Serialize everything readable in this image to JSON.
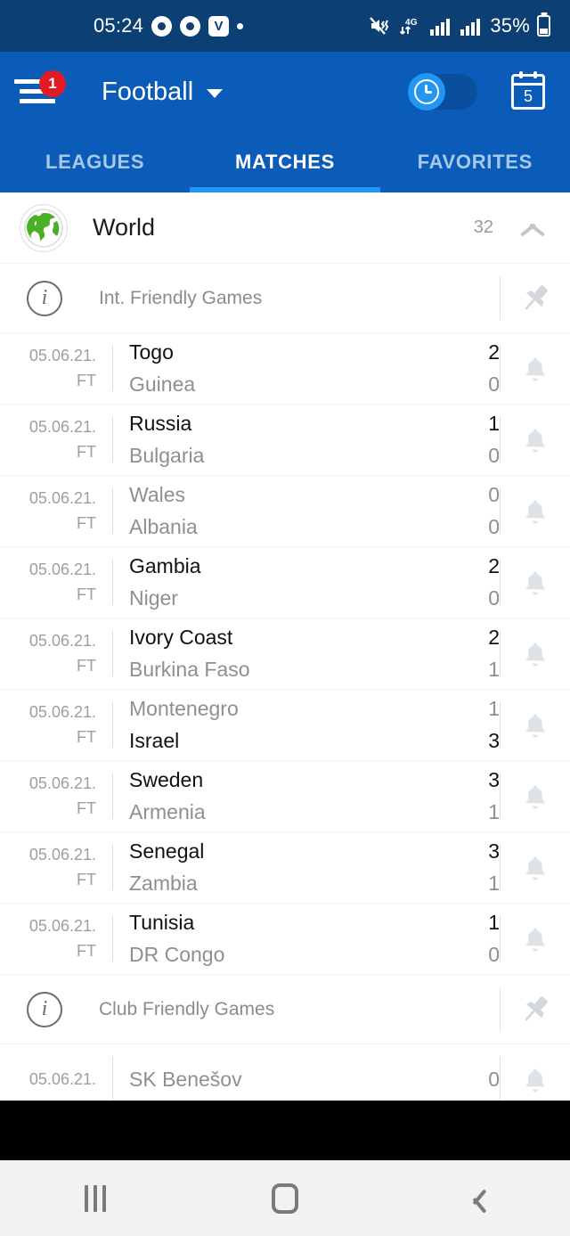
{
  "status_bar": {
    "time": "05:24",
    "battery_percent": "35%",
    "network": "4G",
    "icons": [
      "media-player-icon",
      "chrome-icon",
      "vivaldi-icon",
      "dot-icon",
      "mute-vibrate-icon",
      "4g-data-icon",
      "signal-bars-icon",
      "signal-bars-2-icon",
      "battery-icon"
    ]
  },
  "app_bar": {
    "menu_badge": "1",
    "title": "Football",
    "toggle_state": "off",
    "calendar_day": "5"
  },
  "tabs": [
    {
      "label": "LEAGUES",
      "active": false
    },
    {
      "label": "MATCHES",
      "active": true
    },
    {
      "label": "FAVORITES",
      "active": false
    }
  ],
  "country": {
    "name": "World",
    "count": "32",
    "collapse_icon": "chevron-up-icon"
  },
  "sections": [
    {
      "league": "Int. Friendly Games",
      "matches": [
        {
          "date": "05.06.21.",
          "status": "FT",
          "home": "Togo",
          "away": "Guinea",
          "home_score": "2",
          "away_score": "0",
          "home_win": true,
          "away_win": false
        },
        {
          "date": "05.06.21.",
          "status": "FT",
          "home": "Russia",
          "away": "Bulgaria",
          "home_score": "1",
          "away_score": "0",
          "home_win": true,
          "away_win": false
        },
        {
          "date": "05.06.21.",
          "status": "FT",
          "home": "Wales",
          "away": "Albania",
          "home_score": "0",
          "away_score": "0",
          "home_win": false,
          "away_win": false
        },
        {
          "date": "05.06.21.",
          "status": "FT",
          "home": "Gambia",
          "away": "Niger",
          "home_score": "2",
          "away_score": "0",
          "home_win": true,
          "away_win": false
        },
        {
          "date": "05.06.21.",
          "status": "FT",
          "home": "Ivory Coast",
          "away": "Burkina Faso",
          "home_score": "2",
          "away_score": "1",
          "home_win": true,
          "away_win": false
        },
        {
          "date": "05.06.21.",
          "status": "FT",
          "home": "Montenegro",
          "away": "Israel",
          "home_score": "1",
          "away_score": "3",
          "home_win": false,
          "away_win": true
        },
        {
          "date": "05.06.21.",
          "status": "FT",
          "home": "Sweden",
          "away": "Armenia",
          "home_score": "3",
          "away_score": "1",
          "home_win": true,
          "away_win": false
        },
        {
          "date": "05.06.21.",
          "status": "FT",
          "home": "Senegal",
          "away": "Zambia",
          "home_score": "3",
          "away_score": "1",
          "home_win": true,
          "away_win": false
        },
        {
          "date": "05.06.21.",
          "status": "FT",
          "home": "Tunisia",
          "away": "DR Congo",
          "home_score": "1",
          "away_score": "0",
          "home_win": true,
          "away_win": false
        }
      ]
    },
    {
      "league": "Club Friendly Games",
      "matches": [
        {
          "date": "05.06.21.",
          "status": "",
          "home": "SK Benešov",
          "away": "",
          "home_score": "0",
          "away_score": "",
          "home_win": false,
          "away_win": false
        }
      ]
    }
  ],
  "nav_bar": {
    "recents_label": "recents-button",
    "home_label": "home-button",
    "back_label": "back-button"
  },
  "colors": {
    "status_bar": "#0c3f73",
    "app_bar": "#0b5cb8",
    "tab_indicator": "#2196f3",
    "badge": "#e01b24",
    "globe_green": "#4caf28"
  }
}
